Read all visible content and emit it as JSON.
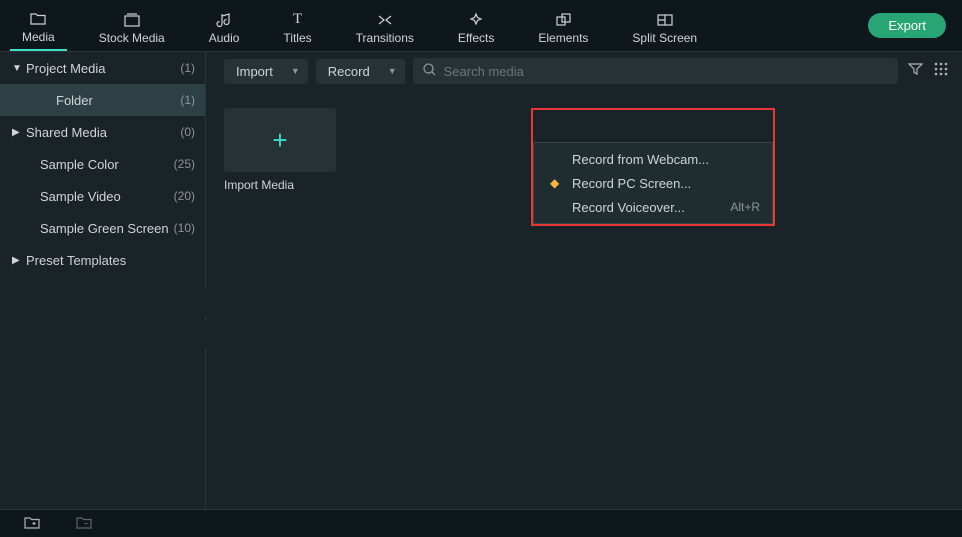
{
  "tabs": [
    {
      "label": "Media"
    },
    {
      "label": "Stock Media"
    },
    {
      "label": "Audio"
    },
    {
      "label": "Titles"
    },
    {
      "label": "Transitions"
    },
    {
      "label": "Effects"
    },
    {
      "label": "Elements"
    },
    {
      "label": "Split Screen"
    }
  ],
  "export_label": "Export",
  "sidebar": {
    "project_media": {
      "label": "Project Media",
      "count": "(1)"
    },
    "folder": {
      "label": "Folder",
      "count": "(1)"
    },
    "shared_media": {
      "label": "Shared Media",
      "count": "(0)"
    },
    "sample_color": {
      "label": "Sample Color",
      "count": "(25)"
    },
    "sample_video": {
      "label": "Sample Video",
      "count": "(20)"
    },
    "sample_green": {
      "label": "Sample Green Screen",
      "count": "(10)"
    },
    "preset": {
      "label": "Preset Templates"
    }
  },
  "toolbar": {
    "import_label": "Import",
    "record_label": "Record",
    "search_placeholder": "Search media"
  },
  "record_menu": [
    {
      "label": "Record from Webcam...",
      "icon": false,
      "shortcut": ""
    },
    {
      "label": "Record PC Screen...",
      "icon": true,
      "shortcut": ""
    },
    {
      "label": "Record Voiceover...",
      "icon": false,
      "shortcut": "Alt+R"
    }
  ],
  "import_tile_label": "Import Media"
}
